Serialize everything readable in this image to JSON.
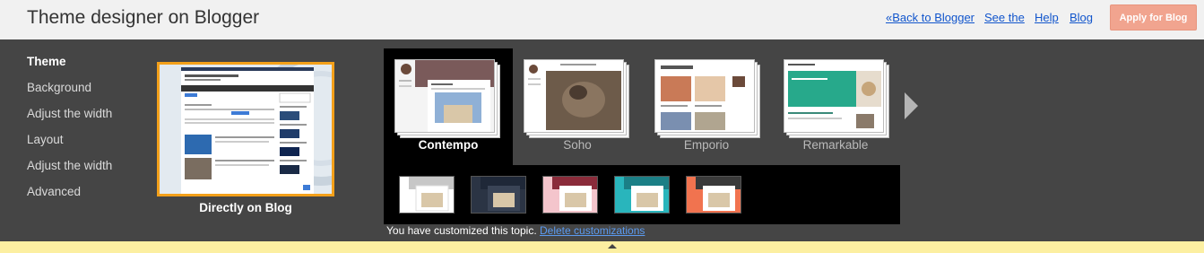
{
  "header": {
    "title": "Theme designer on Blogger",
    "back_link": "«Back to Blogger",
    "see_link": "See the",
    "help_link": "Help",
    "blog_link": "Blog",
    "apply_button": "Apply for Blog"
  },
  "nav": {
    "items": [
      {
        "label": "Theme",
        "active": true
      },
      {
        "label": "Background",
        "active": false
      },
      {
        "label": "Adjust the width",
        "active": false
      },
      {
        "label": "Layout",
        "active": false
      },
      {
        "label": "Adjust the width",
        "active": false
      },
      {
        "label": "Advanced",
        "active": false
      }
    ]
  },
  "current": {
    "caption": "Directly on Blog"
  },
  "themes": [
    {
      "name": "Contempo",
      "selected": true
    },
    {
      "name": "Soho",
      "selected": false
    },
    {
      "name": "Emporio",
      "selected": false
    },
    {
      "name": "Remarkable",
      "selected": false
    }
  ],
  "variants": [
    {
      "accent": "#c7c7c7",
      "bg": "#ffffff"
    },
    {
      "accent": "#1f2838",
      "bg": "#2b3444"
    },
    {
      "accent": "#8a2b3a",
      "bg": "#f4c5cc"
    },
    {
      "accent": "#1b7f86",
      "bg": "#29b5bc"
    },
    {
      "accent": "#3a3a3a",
      "bg": "#f1734f"
    }
  ],
  "status": {
    "message": "You have customized this topic.",
    "delete_link": "Delete customizations"
  },
  "colors": {
    "accent_orange": "#f3a01a",
    "apply_button": "#f1a48f",
    "link": "#1155cc"
  }
}
